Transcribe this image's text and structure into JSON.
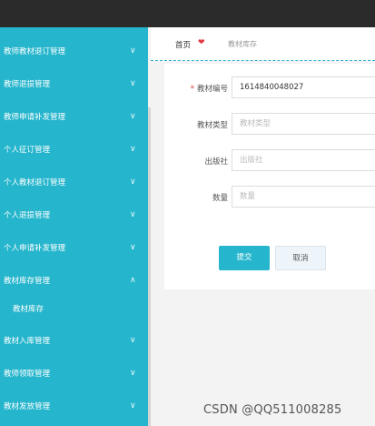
{
  "sidebar": {
    "items": [
      {
        "label": "教师教材退订管理",
        "chevron": "∨"
      },
      {
        "label": "教师退损管理",
        "chevron": "∨"
      },
      {
        "label": "教师申请补发管理",
        "chevron": "∨"
      },
      {
        "label": "个人征订管理",
        "chevron": "∨"
      },
      {
        "label": "个人教材退订管理",
        "chevron": "∨"
      },
      {
        "label": "个人退损管理",
        "chevron": "∨"
      },
      {
        "label": "个人申请补发管理",
        "chevron": "∨"
      },
      {
        "label": "教材库存管理",
        "chevron": "∧"
      },
      {
        "label": "教材入库管理",
        "chevron": "∨"
      },
      {
        "label": "教师领取管理",
        "chevron": "∨"
      },
      {
        "label": "教材发放管理",
        "chevron": "∨"
      }
    ],
    "subitem": {
      "label": "教材库存"
    }
  },
  "breadcrumb": {
    "home": "首页",
    "separator": "❤",
    "current": "教材库存"
  },
  "form": {
    "fields": [
      {
        "label": "教材编号",
        "required": "*",
        "value": "1614840048027",
        "placeholder": ""
      },
      {
        "label": "教材类型",
        "value": "",
        "placeholder": "教材类型"
      },
      {
        "label": "出版社",
        "value": "",
        "placeholder": "出版社"
      },
      {
        "label": "数量",
        "value": "",
        "placeholder": "数量"
      }
    ],
    "submit_label": "提交",
    "cancel_label": "取消"
  },
  "watermark": "CSDN @QQ511008285",
  "colors": {
    "accent": "#25b5cc",
    "topbar": "#2b2b2b",
    "heart": "#e0383e"
  }
}
